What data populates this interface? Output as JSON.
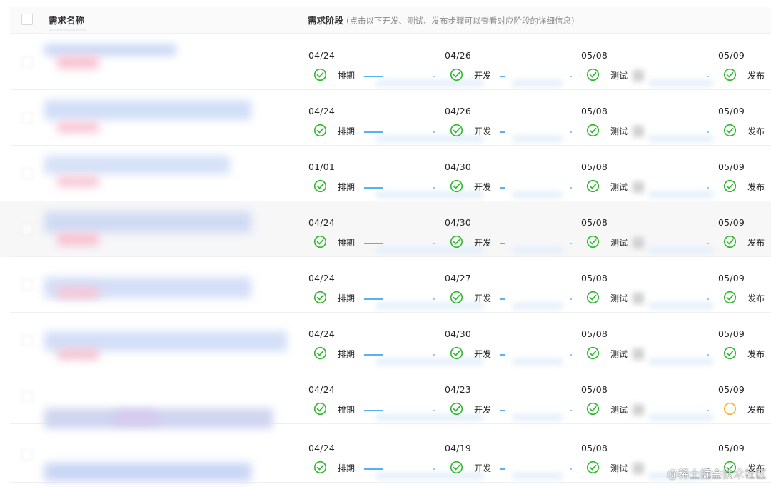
{
  "header": {
    "name_label": "需求名称",
    "stage_label": "需求阶段",
    "stage_hint": "(点击以下开发、测试、发布步骤可以查看对应阶段的详细信息)"
  },
  "step_labels": [
    "排期",
    "开发",
    "测试",
    "发布"
  ],
  "status_colors": {
    "done": "#2eb82e",
    "in_progress": "#f5b52b",
    "connector": "#5ab1ef"
  },
  "icons": {
    "done": "check-circle-icon",
    "in_progress": "pending-circle-icon"
  },
  "rows": [
    {
      "steps": [
        {
          "date": "04/24",
          "label": "排期",
          "status": "done"
        },
        {
          "date": "04/26",
          "label": "开发",
          "status": "done"
        },
        {
          "date": "05/08",
          "label": "测试",
          "status": "done"
        },
        {
          "date": "05/09",
          "label": "发布",
          "status": "done"
        }
      ]
    },
    {
      "steps": [
        {
          "date": "04/24",
          "label": "排期",
          "status": "done"
        },
        {
          "date": "04/26",
          "label": "开发",
          "status": "done"
        },
        {
          "date": "05/08",
          "label": "测试",
          "status": "done"
        },
        {
          "date": "05/09",
          "label": "发布",
          "status": "done"
        }
      ]
    },
    {
      "steps": [
        {
          "date": "01/01",
          "label": "排期",
          "status": "done"
        },
        {
          "date": "04/30",
          "label": "开发",
          "status": "done"
        },
        {
          "date": "05/08",
          "label": "测试",
          "status": "done"
        },
        {
          "date": "05/09",
          "label": "发布",
          "status": "done"
        }
      ]
    },
    {
      "steps": [
        {
          "date": "04/24",
          "label": "排期",
          "status": "done"
        },
        {
          "date": "04/30",
          "label": "开发",
          "status": "done"
        },
        {
          "date": "05/08",
          "label": "测试",
          "status": "done"
        },
        {
          "date": "05/09",
          "label": "发布",
          "status": "done"
        }
      ]
    },
    {
      "steps": [
        {
          "date": "04/24",
          "label": "排期",
          "status": "done"
        },
        {
          "date": "04/27",
          "label": "开发",
          "status": "done"
        },
        {
          "date": "05/08",
          "label": "测试",
          "status": "done"
        },
        {
          "date": "05/09",
          "label": "发布",
          "status": "done"
        }
      ]
    },
    {
      "steps": [
        {
          "date": "04/24",
          "label": "排期",
          "status": "done"
        },
        {
          "date": "04/30",
          "label": "开发",
          "status": "done"
        },
        {
          "date": "05/08",
          "label": "测试",
          "status": "done"
        },
        {
          "date": "05/09",
          "label": "发布",
          "status": "done"
        }
      ]
    },
    {
      "steps": [
        {
          "date": "04/24",
          "label": "排期",
          "status": "done"
        },
        {
          "date": "04/23",
          "label": "开发",
          "status": "done"
        },
        {
          "date": "05/08",
          "label": "测试",
          "status": "done"
        },
        {
          "date": "05/09",
          "label": "发布",
          "status": "in_progress"
        }
      ]
    },
    {
      "steps": [
        {
          "date": "04/24",
          "label": "排期",
          "status": "done"
        },
        {
          "date": "04/19",
          "label": "开发",
          "status": "done"
        },
        {
          "date": "05/08",
          "label": "测试",
          "status": "done"
        },
        {
          "date": "05/09",
          "label": "发布",
          "status": "done"
        }
      ]
    }
  ],
  "watermark": "@稀土掘金技术社区"
}
